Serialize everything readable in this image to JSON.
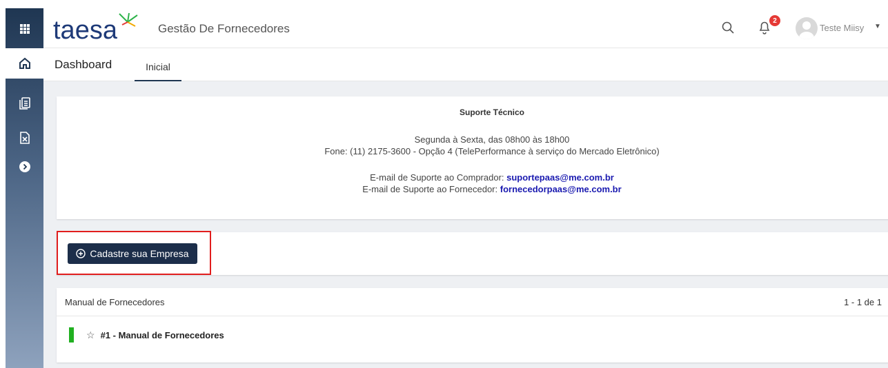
{
  "header": {
    "logo_text": "taesa",
    "app_title": "Gestão De Fornecedores",
    "notifications_count": "2",
    "user_name": "Teste Miisy"
  },
  "tabs": {
    "page_title": "Dashboard",
    "active_tab": "Inicial"
  },
  "support": {
    "title": "Suporte Técnico",
    "hours": "Segunda à Sexta, das 08h00 às 18h00",
    "phone": "Fone: (11) 2175-3600 - Opção 4 (TelePerformance à serviço do Mercado Eletrônico)",
    "buyer_label": "E-mail de Suporte ao Comprador: ",
    "buyer_email": "suportepaas@me.com.br",
    "supplier_label": "E-mail de Suporte ao Fornecedor: ",
    "supplier_email": "fornecedorpaas@me.com.br"
  },
  "register": {
    "button_label": "Cadastre sua Empresa"
  },
  "manual": {
    "title": "Manual de Fornecedores",
    "pager": "1 - 1 de 1",
    "item_label": "#1 - Manual de Fornecedores"
  },
  "colors": {
    "rail_top": "#1f3652",
    "button": "#1c2e4a",
    "link": "#1a1ab0",
    "highlight": "#e11d1d",
    "status_green": "#21b021"
  }
}
